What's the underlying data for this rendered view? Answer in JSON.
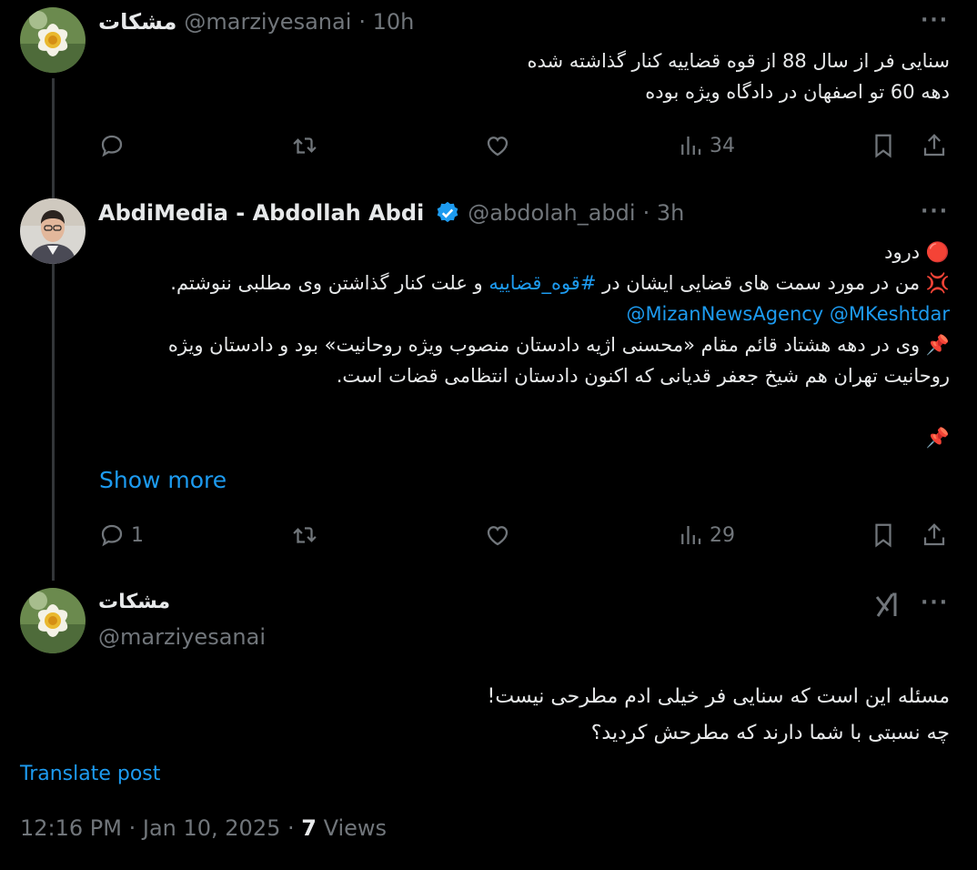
{
  "tweet1": {
    "name": "مشکات",
    "handle": "@marziyesanai",
    "time": "· 10h",
    "lines": [
      "سنایی فر از سال 88 از قوه قضاییه کنار گذاشته شده",
      "دهه 60 تو اصفهان در دادگاه ویژه بوده"
    ],
    "views": "34"
  },
  "tweet2": {
    "name": "AbdiMedia - Abdollah Abdi",
    "handle": "@abdolah_abdi",
    "time": "· 3h",
    "line1": "درود",
    "line2_pre": "من در مورد سمت های قضایی ایشان در ",
    "hashtag": "#قوه_قضاییه",
    "line2_post": " و علت کنار گذاشتن وی مطلبی ننوشتم.",
    "mentions": "@MizanNewsAgency @MKeshtdar",
    "line4": "وی در دهه هشتاد قائم مقام «محسنی اژیه دادستان منصوب ویژه روحانیت» بود و دادستان ویژه",
    "line5": "روحانیت تهران هم شیخ جعفر قدیانی که اکنون دادستان انتظامی قضات است.",
    "emoji_red_circle": "🔴",
    "emoji_anger": "💢",
    "emoji_pin": "📌",
    "show_more": "Show more",
    "replies": "1",
    "views": "29"
  },
  "tweet3": {
    "name": "مشکات",
    "handle": "@marziyesanai",
    "lines": [
      "مسئله این است که سنایی فر خیلی ادم مطرحی نیست!",
      "چه نسبتی با شما دارند که مطرحش کردید؟"
    ],
    "translate": "Translate post",
    "time": "12:16 PM · Jan 10, 2025",
    "dot": " · ",
    "views_count": "7",
    "views_label": " Views"
  },
  "icons": [
    "reply-icon",
    "retweet-icon",
    "like-icon",
    "views-icon",
    "bookmark-icon",
    "share-icon",
    "more-icon",
    "verified-badge-icon",
    "grok-icon"
  ],
  "colors": {
    "background": "#000000",
    "text": "#e7e9ea",
    "muted": "#71767b",
    "link": "#1d9bf0",
    "line": "#333639"
  }
}
